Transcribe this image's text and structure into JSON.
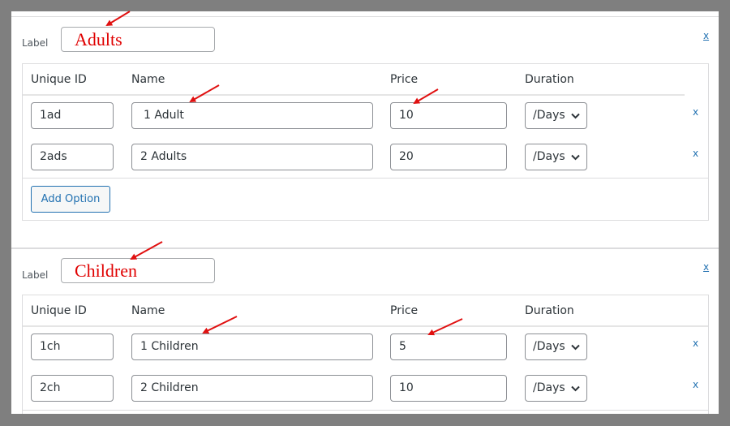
{
  "sections": [
    {
      "label_caption": "Label",
      "label_value": "Adults",
      "remove_label": "x",
      "headers": [
        "Unique ID",
        "Name",
        "Price",
        "Duration"
      ],
      "rows": [
        {
          "id": "1ad",
          "name": "1 Adult",
          "price": "10",
          "duration": "/Days",
          "remove": "x"
        },
        {
          "id": "2ads",
          "name": "2 Adults",
          "price": "20",
          "duration": "/Days",
          "remove": "x"
        }
      ],
      "add_option_label": "Add Option"
    },
    {
      "label_caption": "Label",
      "label_value": "Children",
      "remove_label": "x",
      "headers": [
        "Unique ID",
        "Name",
        "Price",
        "Duration"
      ],
      "rows": [
        {
          "id": "1ch",
          "name": "1 Children",
          "price": "5",
          "duration": "/Days",
          "remove": "x"
        },
        {
          "id": "2ch",
          "name": "2 Children",
          "price": "10",
          "duration": "/Days",
          "remove": "x"
        }
      ]
    }
  ],
  "colors": {
    "annotation_arrow": "#e01010",
    "link": "#2271b1",
    "label_text": "#e00000"
  },
  "icons": {
    "select_caret": "chevron-down-icon",
    "annotation": "red-arrow-icon"
  }
}
